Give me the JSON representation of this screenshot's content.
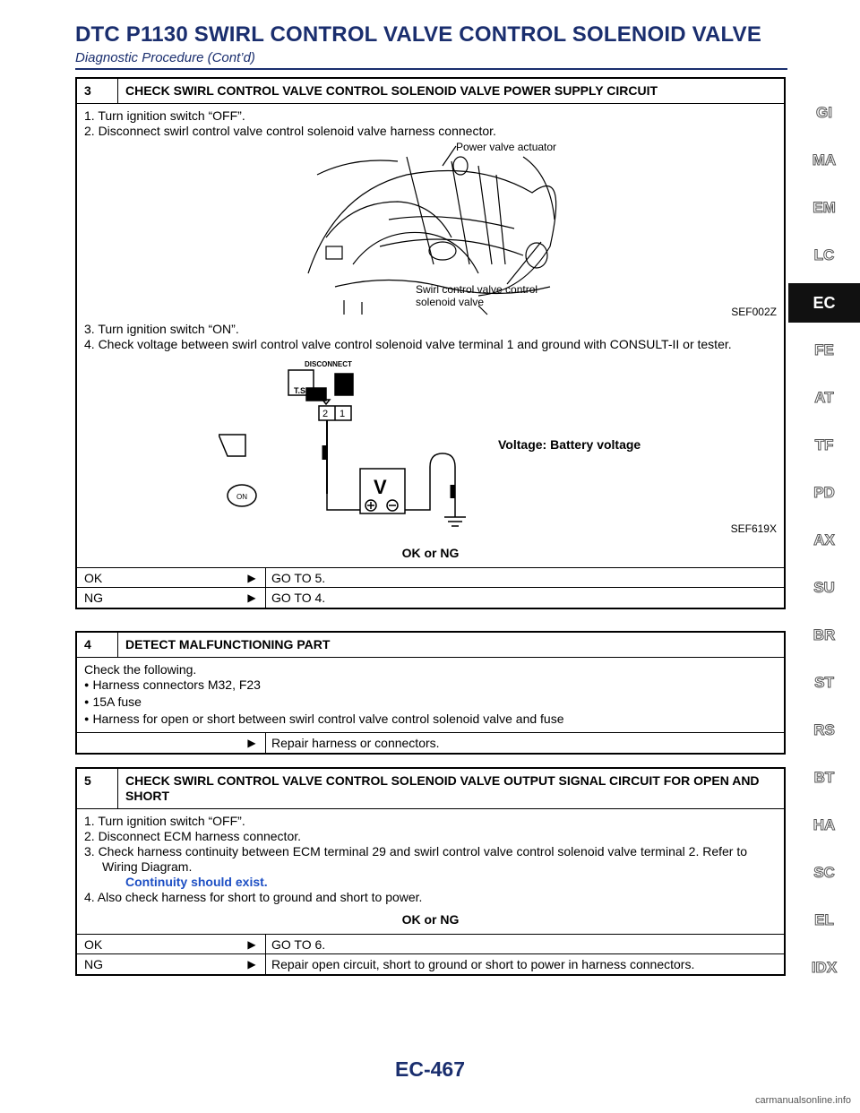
{
  "header": {
    "title": "DTC P1130 SWIRL CONTROL VALVE CONTROL SOLENOID VALVE",
    "subtitle": "Diagnostic Procedure (Cont’d)"
  },
  "step3": {
    "num": "3",
    "title": "CHECK SWIRL CONTROL VALVE CONTROL SOLENOID VALVE POWER SUPPLY CIRCUIT",
    "line1": "1. Turn ignition switch “OFF”.",
    "line2": "2. Disconnect swirl control valve control solenoid valve harness connector.",
    "fig1": {
      "label_actuator": "Power valve actuator",
      "label_solenoid1": "Swirl control valve control",
      "label_solenoid2": "solenoid valve",
      "code": "SEF002Z"
    },
    "line3": "3. Turn ignition switch “ON”.",
    "line4": "4. Check voltage between swirl control valve control solenoid valve terminal 1 and ground with CONSULT-II or tester.",
    "fig2": {
      "disconnect": "DISCONNECT",
      "ts": "T.S.",
      "pin2": "2",
      "pin1": "1",
      "meter": "V",
      "on": "ON",
      "voltage": "Voltage: Battery voltage",
      "code": "SEF619X"
    },
    "okng": "OK or NG",
    "results": [
      {
        "key": "OK",
        "value": "GO TO 5."
      },
      {
        "key": "NG",
        "value": "GO TO 4."
      }
    ]
  },
  "step4": {
    "num": "4",
    "title": "DETECT MALFUNCTIONING PART",
    "intro": "Check the following.",
    "bullets": [
      "Harness connectors M32, F23",
      "15A fuse",
      "Harness for open or short between swirl control valve control solenoid valve and fuse"
    ],
    "result": "Repair harness or connectors."
  },
  "step5": {
    "num": "5",
    "title": "CHECK SWIRL CONTROL VALVE CONTROL SOLENOID VALVE OUTPUT SIGNAL CIRCUIT FOR OPEN AND SHORT",
    "line1": "1. Turn ignition switch “OFF”.",
    "line2": "2. Disconnect ECM harness connector.",
    "line3a": "3. Check harness continuity between ECM terminal 29 and swirl control valve control solenoid valve terminal 2. Refer to",
    "line3b": "Wiring Diagram.",
    "continuity": "Continuity should exist.",
    "line4": "4. Also check harness for short to ground and short to power.",
    "okng": "OK or NG",
    "results": [
      {
        "key": "OK",
        "value": "GO TO 6."
      },
      {
        "key": "NG",
        "value": "Repair open circuit, short to ground or short to power in harness connectors."
      }
    ]
  },
  "sidetabs": [
    "GI",
    "MA",
    "EM",
    "LC",
    "EC",
    "FE",
    "AT",
    "TF",
    "PD",
    "AX",
    "SU",
    "BR",
    "ST",
    "RS",
    "BT",
    "HA",
    "SC",
    "EL",
    "IDX"
  ],
  "active_tab": "EC",
  "page_number": "EC-467",
  "footer": "carmanualsonline.info"
}
